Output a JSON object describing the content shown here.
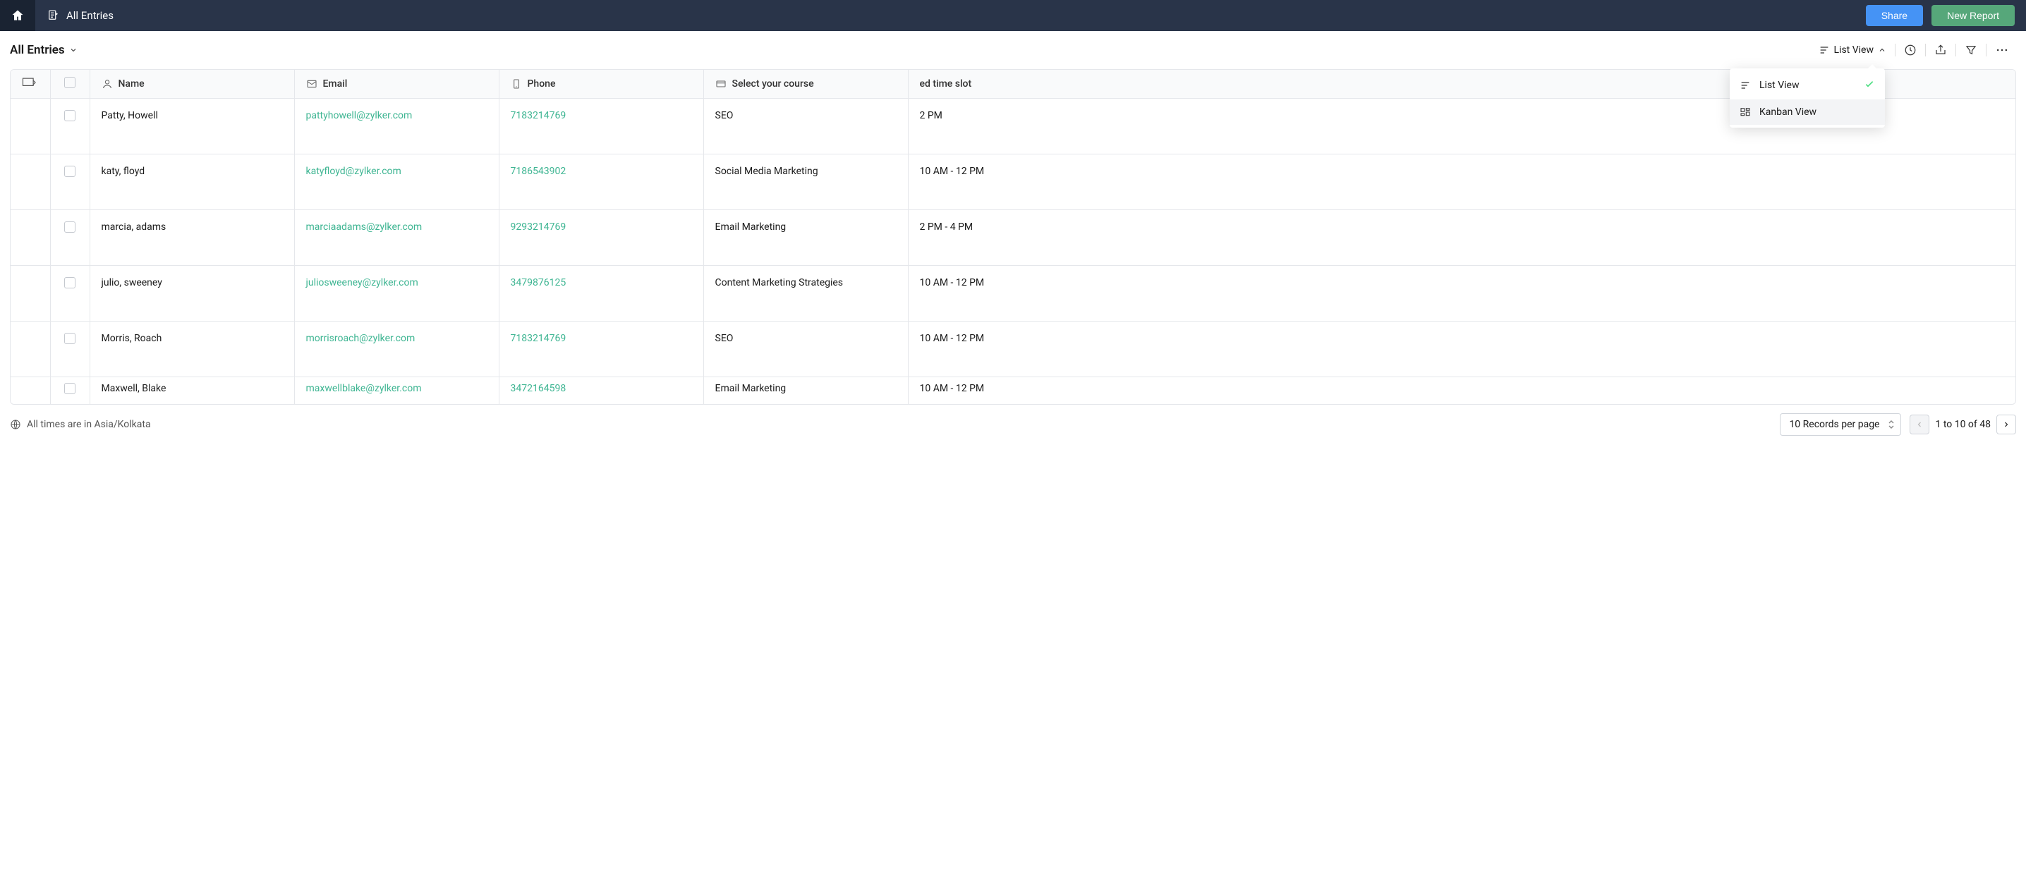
{
  "topbar": {
    "title": "All Entries",
    "share_label": "Share",
    "new_report_label": "New Report"
  },
  "subbar": {
    "title": "All Entries",
    "listview_label": "List View"
  },
  "view_dropdown": {
    "items": [
      {
        "label": "List View",
        "selected": true
      },
      {
        "label": "Kanban View",
        "selected": false
      }
    ]
  },
  "columns": {
    "name": "Name",
    "email": "Email",
    "phone": "Phone",
    "course": "Select your course",
    "timeslot": "ed time slot"
  },
  "rows": [
    {
      "name": "Patty, Howell",
      "email": "pattyhowell@zylker.com",
      "phone": "7183214769",
      "course": "SEO",
      "timeslot": "2 PM"
    },
    {
      "name": "katy, floyd",
      "email": "katyfloyd@zylker.com",
      "phone": "7186543902",
      "course": "Social Media Marketing",
      "timeslot": "10 AM - 12 PM"
    },
    {
      "name": "marcia, adams",
      "email": "marciaadams@zylker.com",
      "phone": "9293214769",
      "course": "Email Marketing",
      "timeslot": "2 PM - 4 PM"
    },
    {
      "name": "julio, sweeney",
      "email": "juliosweeney@zylker.com",
      "phone": "3479876125",
      "course": "Content Marketing Strategies",
      "timeslot": "10 AM - 12 PM"
    },
    {
      "name": "Morris, Roach",
      "email": "morrisroach@zylker.com",
      "phone": "7183214769",
      "course": "SEO",
      "timeslot": "10 AM - 12 PM"
    },
    {
      "name": "Maxwell, Blake",
      "email": "maxwellblake@zylker.com",
      "phone": "3472164598",
      "course": "Email Marketing",
      "timeslot": "10 AM - 12 PM"
    }
  ],
  "footer": {
    "tz_text": "All times are in Asia/Kolkata",
    "per_page_label": "10 Records per page",
    "page_info": "1 to 10 of 48"
  }
}
